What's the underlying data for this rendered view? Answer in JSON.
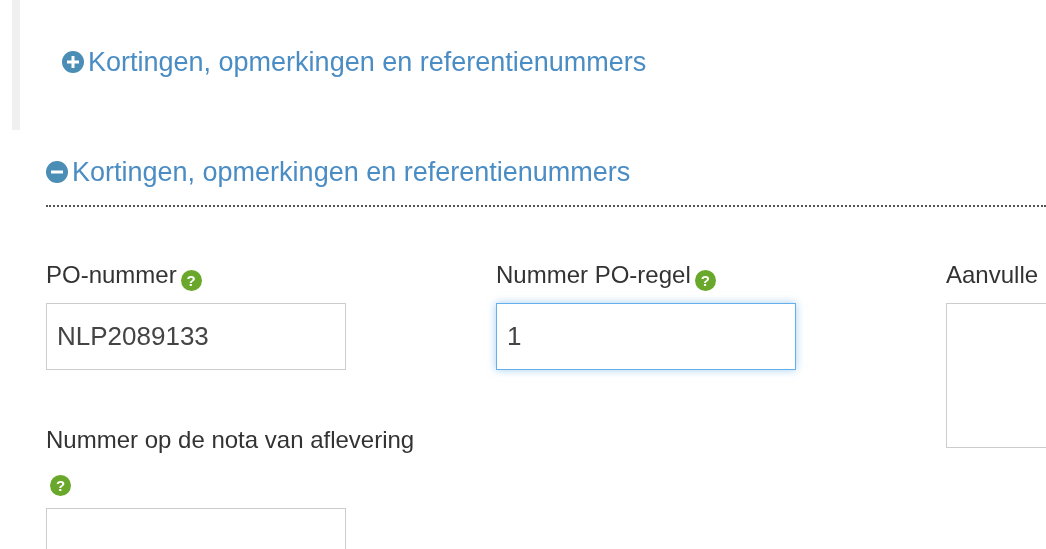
{
  "sections": [
    {
      "label": "Kortingen, opmerkingen en referentienummers",
      "expanded": false
    },
    {
      "label": "Kortingen, opmerkingen en referentienummers",
      "expanded": true
    }
  ],
  "form": {
    "columns": [
      [
        {
          "kind": "input",
          "label": "PO-nummer",
          "help": "?",
          "value": "NLP2089133",
          "focused": false
        },
        {
          "kind": "input",
          "label": "Nummer op de nota van aflevering",
          "help": "?",
          "focused": false
        }
      ],
      [
        {
          "kind": "input",
          "label": "Nummer PO-regel",
          "help": "?",
          "value": "1",
          "focused": true
        }
      ],
      [
        {
          "kind": "textarea",
          "label": "Aanvulle",
          "focused": false
        }
      ]
    ]
  }
}
